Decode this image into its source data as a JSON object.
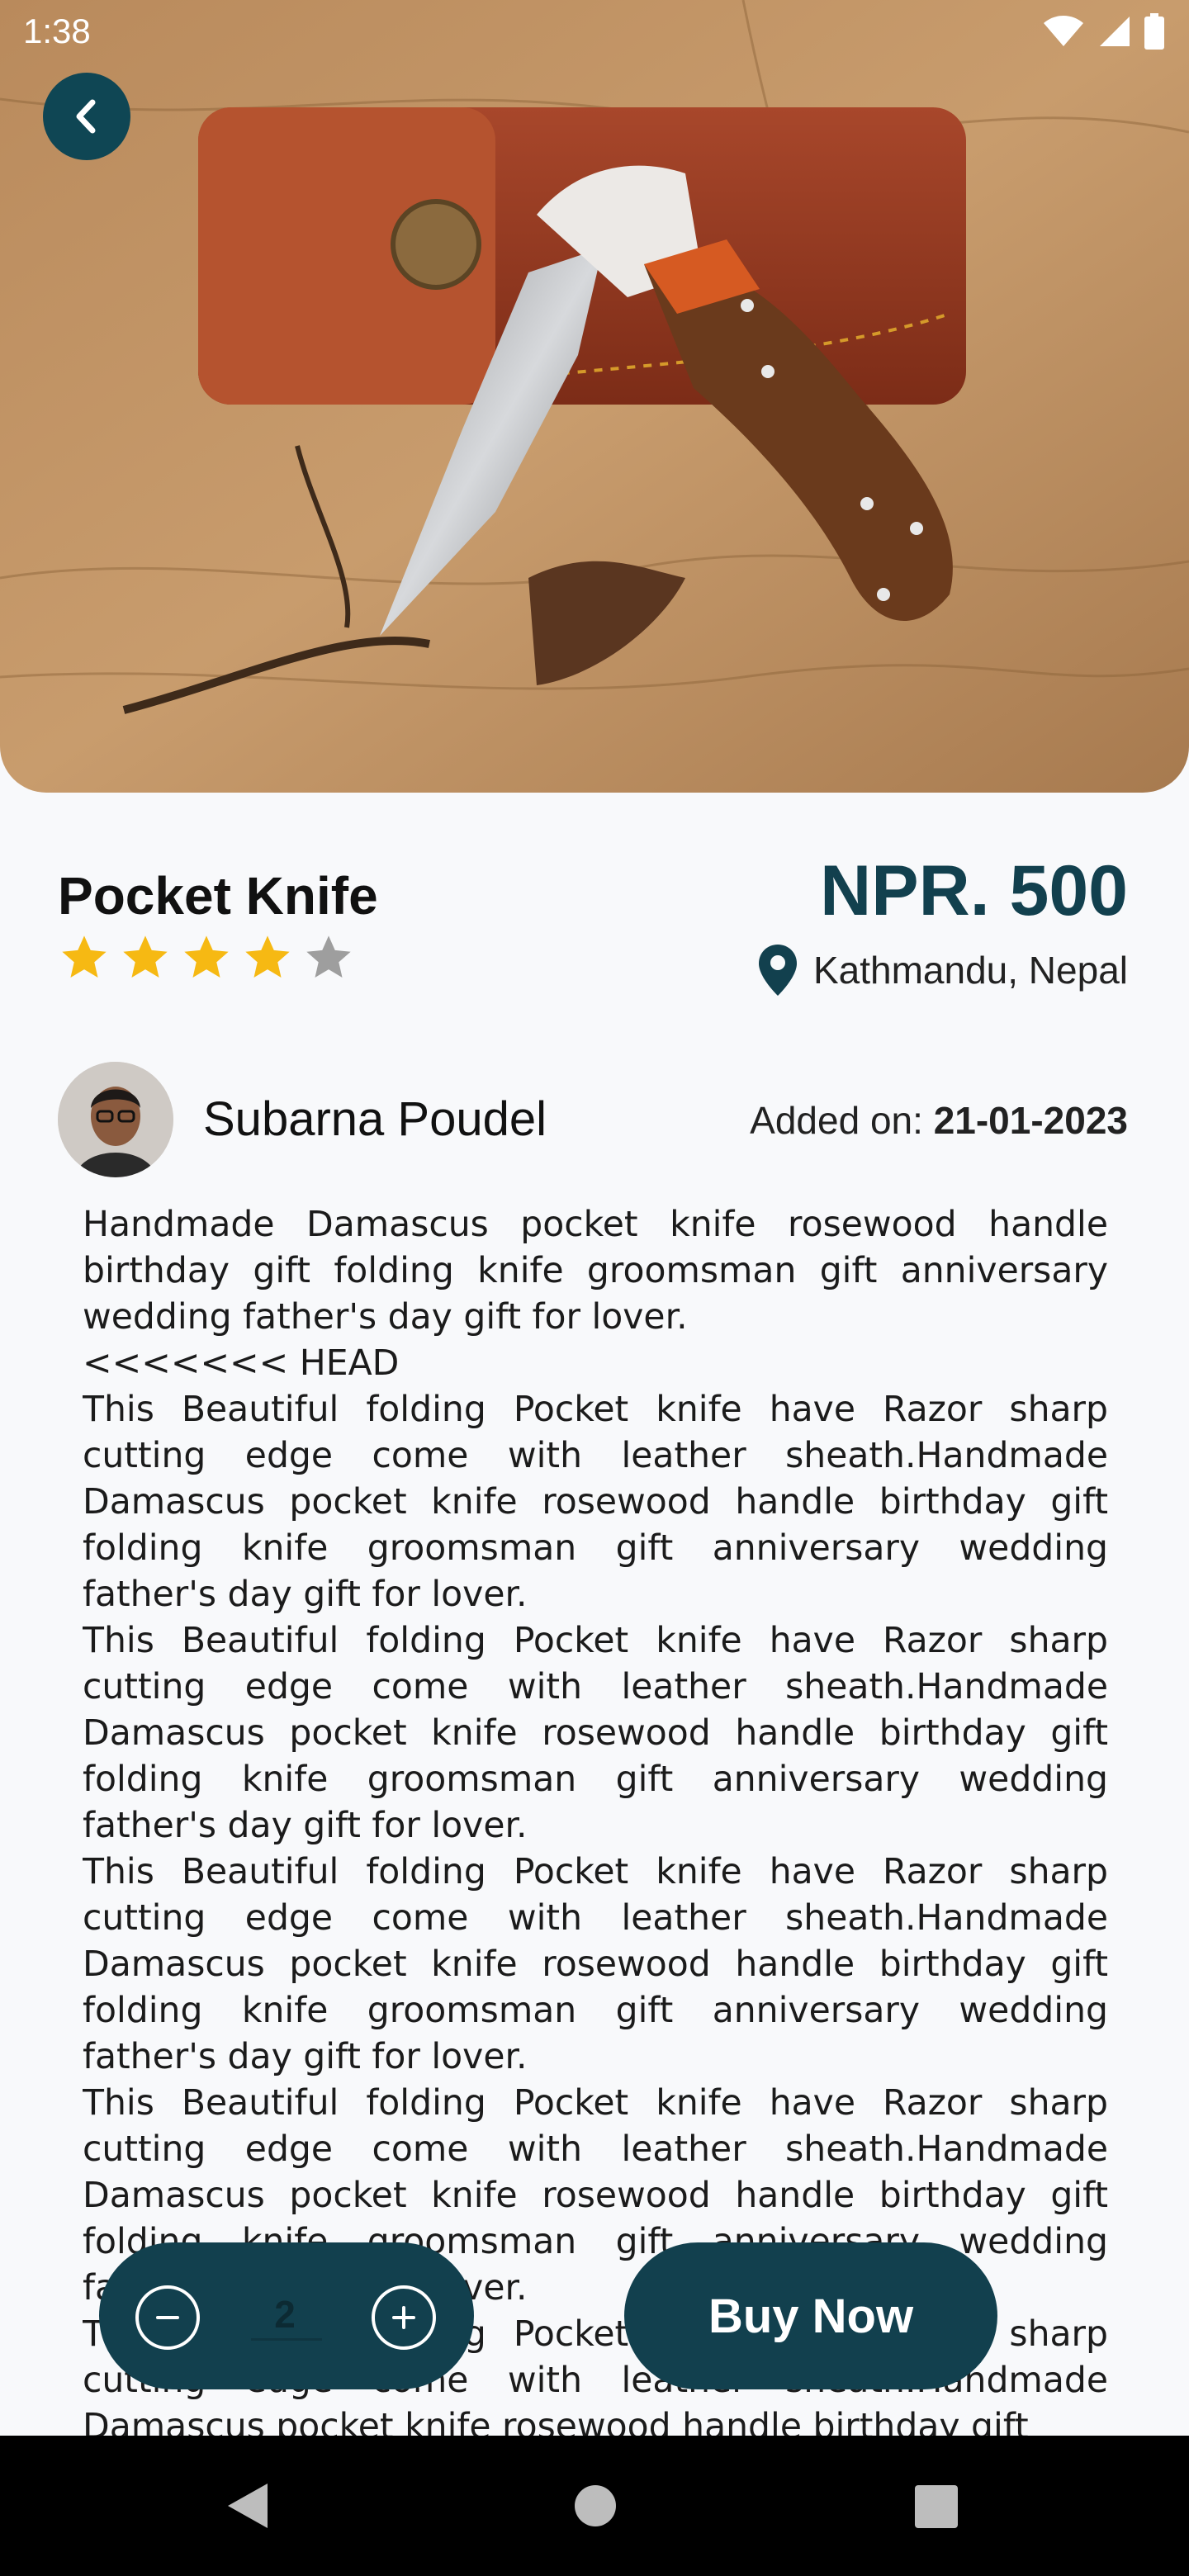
{
  "status_bar": {
    "time": "1:38"
  },
  "product": {
    "title": "Pocket Knife",
    "price": "NPR. 500",
    "rating": 4,
    "rating_max": 5,
    "location": "Kathmandu, Nepal"
  },
  "seller": {
    "name": "Subarna Poudel",
    "added_on_label": "Added on:",
    "added_on_date": "21-01-2023"
  },
  "description": "Handmade Damascus pocket knife rosewood handle birthday gift folding knife groomsman gift anniversary wedding father's day gift for lover.\n<<<<<<< HEAD\nThis Beautiful folding Pocket knife have Razor sharp cutting edge come with leather sheath.Handmade Damascus pocket knife rosewood handle birthday gift folding knife groomsman gift anniversary wedding father's day gift for lover.\nThis Beautiful folding Pocket knife have Razor sharp cutting edge come with leather sheath.Handmade Damascus pocket knife rosewood handle birthday gift folding knife groomsman gift anniversary wedding father's day gift for lover.\nThis Beautiful folding Pocket knife have Razor sharp cutting edge come with leather sheath.Handmade Damascus pocket knife rosewood handle birthday gift folding knife groomsman gift anniversary wedding father's day gift for lover.\nThis Beautiful folding Pocket knife have Razor sharp cutting edge come with leather sheath.Handmade Damascus pocket knife rosewood handle birthday gift folding knife groomsman gift anniversary wedding father's day gift for lover.\nThis Beautiful folding Pocket knife have Razor sharp cutting edge come with leather sheath.Handmade Damascus pocket knife rosewood handle birthday gift",
  "cart": {
    "quantity": "2",
    "buy_label": "Buy Now"
  },
  "colors": {
    "primary": "#12404e",
    "star_active": "#f6b913",
    "star_inactive": "#9e9e9e"
  },
  "icons": {
    "back": "chevron-left-icon",
    "minus": "minus-circle-icon",
    "plus": "plus-circle-icon",
    "location": "map-pin-icon"
  }
}
